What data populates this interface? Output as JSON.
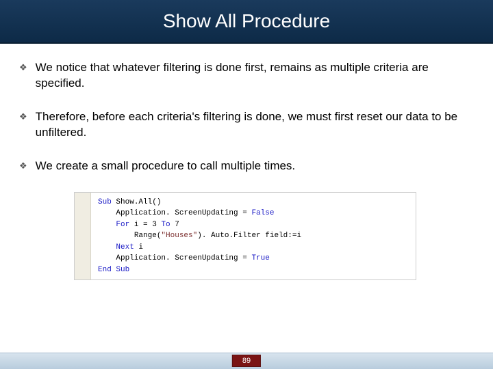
{
  "header": {
    "title": "Show All Procedure"
  },
  "bullets": [
    {
      "text": "We notice that whatever filtering is done first, remains as multiple criteria are specified."
    },
    {
      "text": "Therefore, before each criteria's filtering is done, we must first reset our data to be unfiltered."
    },
    {
      "text": "We create a small procedure to call multiple times."
    }
  ],
  "code": {
    "lines": [
      {
        "kw": "Sub",
        "rest": " Show.All()"
      },
      {
        "indent": 4,
        "rest": "Application. ScreenUpdating = ",
        "kw2": "False"
      },
      {
        "indent": 4,
        "kw": "For",
        "rest": " i = 3 ",
        "kw2": "To",
        "rest2": " 7"
      },
      {
        "indent": 8,
        "rest": "Range(",
        "str": "\"Houses\"",
        "rest2": "). Auto.Filter field:=i"
      },
      {
        "indent": 4,
        "kw": "Next",
        "rest": " i"
      },
      {
        "indent": 4,
        "rest": "Application. ScreenUpdating = ",
        "kw2": "True"
      },
      {
        "kw": "End Sub",
        "rest": ""
      }
    ]
  },
  "footer": {
    "page": "89"
  }
}
